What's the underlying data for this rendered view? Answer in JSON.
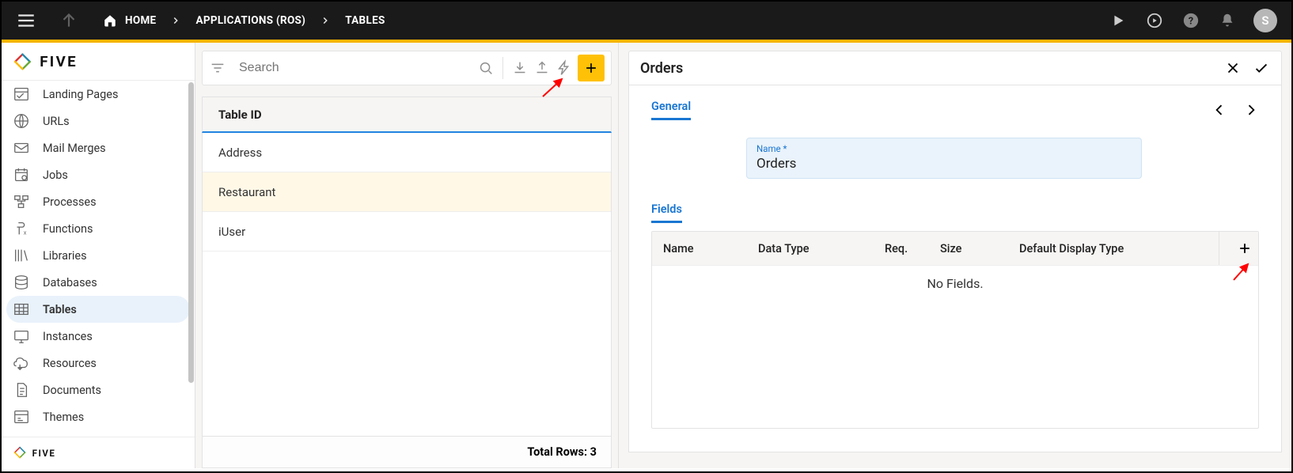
{
  "topbar": {
    "breadcrumbs": [
      "HOME",
      "APPLICATIONS (ROS)",
      "TABLES"
    ],
    "avatar_letter": "S"
  },
  "sidebar": {
    "items": [
      {
        "label": "Landing Pages"
      },
      {
        "label": "URLs"
      },
      {
        "label": "Mail Merges"
      },
      {
        "label": "Jobs"
      },
      {
        "label": "Processes"
      },
      {
        "label": "Functions"
      },
      {
        "label": "Libraries"
      },
      {
        "label": "Databases"
      },
      {
        "label": "Tables",
        "active": true
      },
      {
        "label": "Instances"
      },
      {
        "label": "Resources"
      },
      {
        "label": "Documents"
      },
      {
        "label": "Themes"
      }
    ]
  },
  "middle": {
    "search_placeholder": "Search",
    "column_header": "Table ID",
    "rows": [
      "Address",
      "Restaurant",
      "iUser"
    ],
    "selected_index": 1,
    "total_label": "Total Rows: 3"
  },
  "right": {
    "title": "Orders",
    "tab_general": "General",
    "name_label": "Name *",
    "name_value": "Orders",
    "fields_label": "Fields",
    "columns": {
      "name": "Name",
      "type": "Data Type",
      "req": "Req.",
      "size": "Size",
      "disp": "Default Display Type"
    },
    "empty_text": "No Fields."
  }
}
